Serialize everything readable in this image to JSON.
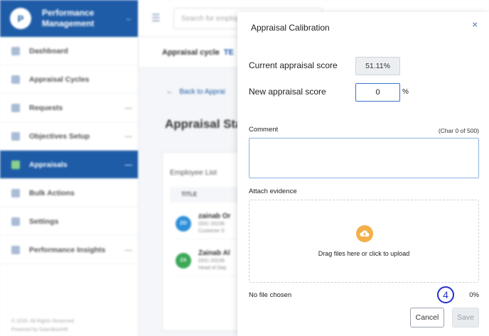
{
  "sidebar": {
    "brand_title": "Performance Management",
    "brand_logo": "P",
    "items": [
      {
        "label": "Dashboard",
        "icon": "dashboard-icon"
      },
      {
        "label": "Appraisal Cycles",
        "icon": "cycle-icon"
      },
      {
        "label": "Requests",
        "icon": "list-icon"
      },
      {
        "label": "Objectives Setup",
        "icon": "target-icon"
      },
      {
        "label": "Appraisals",
        "icon": "document-icon"
      },
      {
        "label": "Bulk Actions",
        "icon": "bulk-icon"
      },
      {
        "label": "Settings",
        "icon": "gear-icon"
      },
      {
        "label": "Performance Insights",
        "icon": "chart-icon"
      }
    ],
    "footer_line1": "© 2026. All Rights Reserved.",
    "footer_line2": "Powered by SeamlessHR"
  },
  "topbar": {
    "search_placeholder": "Search for employee"
  },
  "main": {
    "cycle_label": "Appraisal cycle",
    "cycle_value": "TE",
    "back_link": "Back to Apprai",
    "heading": "Appraisal Sta",
    "panel_title": "Employee List",
    "table_header": "TITLE",
    "employees": [
      {
        "initials": "ZO",
        "name": "zainab Or",
        "code": "DDC-20236",
        "role": "Customer S",
        "color": "#2f8fd8"
      },
      {
        "initials": "ZA",
        "name": "Zainab Al",
        "code": "DDC-20236",
        "role": "Head of Dep",
        "color": "#3aa856"
      }
    ]
  },
  "modal": {
    "title": "Appraisal Calibration",
    "close_label": "×",
    "current_score_label": "Current appraisal score",
    "current_score_value": "51.11%",
    "new_score_label": "New appraisal score",
    "new_score_value": "0",
    "percent_sign": "%",
    "comment_label": "Comment",
    "char_count": "(Char 0 of 500)",
    "attach_label": "Attach evidence",
    "dropzone_text": "Drag files here or click to upload",
    "no_file_text": "No file chosen",
    "step_number": "4",
    "upload_progress": "0%",
    "cancel_label": "Cancel",
    "save_label": "Save"
  },
  "colors": {
    "brand": "#1f5ca8",
    "upload_accent": "#f3b04a",
    "step_badge": "#2431c8"
  }
}
